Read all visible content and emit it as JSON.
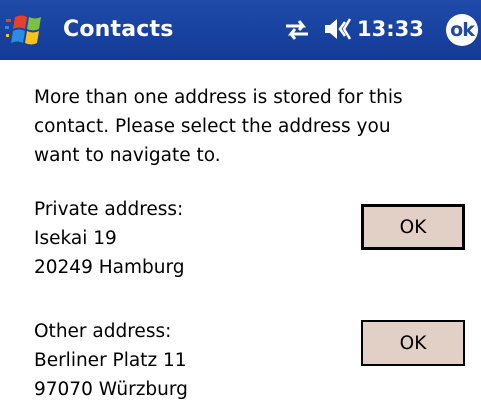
{
  "titlebar": {
    "title": "Contacts",
    "time": "13:33",
    "ok_label": "ok",
    "start_icon": "windows-flag-icon",
    "connectivity_icon": "connectivity-icon",
    "volume_icon": "speaker-icon",
    "background_color": "#1f4aa8"
  },
  "dialog": {
    "message_lines": [
      "More than one address is stored for this",
      "contact. Please select the address you",
      "want to navigate to."
    ],
    "addresses": [
      {
        "heading": "Private address:",
        "street": "Isekai 19",
        "city": "20249 Hamburg",
        "button_label": "OK"
      },
      {
        "heading": "Other address:",
        "street": "Berliner Platz 11",
        "city": "97070 Würzburg",
        "button_label": "OK"
      }
    ],
    "button_color": "#e2cfc6"
  }
}
